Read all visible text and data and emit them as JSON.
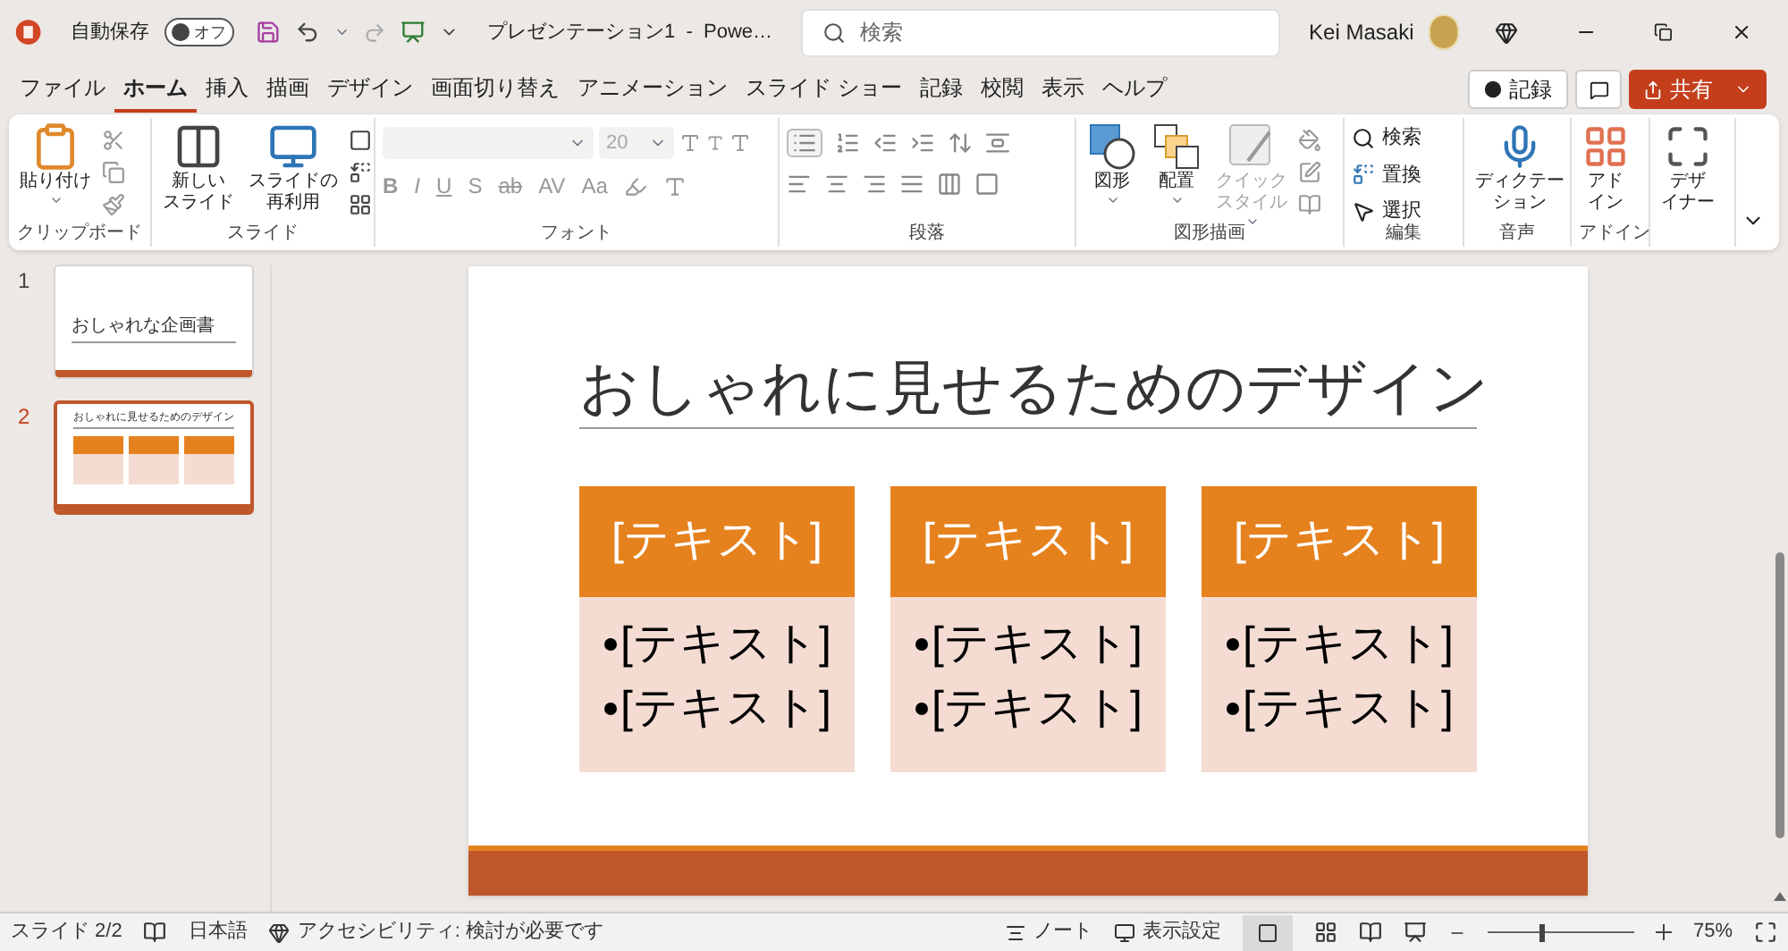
{
  "title_bar": {
    "autosave_label": "自動保存",
    "autosave": {
      "label": "オフ",
      "on": false
    },
    "document_title": "プレゼンテーション1  -  Powe…",
    "search": {
      "placeholder": "検索"
    },
    "user": "Kei Masaki"
  },
  "menu_tabs": [
    {
      "label": "ファイル",
      "selected": false
    },
    {
      "label": "ホーム",
      "selected": true
    },
    {
      "label": "挿入",
      "selected": false
    },
    {
      "label": "描画",
      "selected": false
    },
    {
      "label": "デザイン",
      "selected": false
    },
    {
      "label": "画面切り替え",
      "selected": false
    },
    {
      "label": "アニメーション",
      "selected": false
    },
    {
      "label": "スライド ショー",
      "selected": false
    },
    {
      "label": "記録",
      "selected": false
    },
    {
      "label": "校閲",
      "selected": false
    },
    {
      "label": "表示",
      "selected": false
    },
    {
      "label": "ヘルプ",
      "selected": false
    }
  ],
  "header_buttons": {
    "record": "記録",
    "share": "共有"
  },
  "ribbon": {
    "clipboard": {
      "paste": [
        "貼り付け"
      ],
      "label": "クリップボード"
    },
    "slides": {
      "new_slide": [
        "新しい",
        "スライド"
      ],
      "reuse": [
        "スライドの",
        "再利用"
      ],
      "label": "スライド"
    },
    "font": {
      "size": "20",
      "buttons": [
        "B",
        "I",
        "U",
        "S",
        "ab",
        "AV",
        "Aa"
      ],
      "label": "フォント"
    },
    "paragraph": {
      "label": "段落"
    },
    "drawing": {
      "items": [
        {
          "kind": "shapes",
          "label": [
            "図形"
          ],
          "disabled": false
        },
        {
          "kind": "arrange",
          "label": [
            "配置"
          ],
          "disabled": false
        },
        {
          "kind": "quick_style",
          "label": [
            "クイック",
            "スタイル"
          ],
          "disabled": true
        }
      ],
      "label": "図形描画"
    },
    "editing": {
      "items": [
        {
          "kind": "find",
          "label": "検索"
        },
        {
          "kind": "replace",
          "label": "置換"
        },
        {
          "kind": "select",
          "label": "選択"
        }
      ],
      "label": "編集"
    },
    "voice": {
      "dictate": [
        "ディクテー",
        "ション"
      ],
      "label": "音声"
    },
    "addins": {
      "button": [
        "アド",
        "イン"
      ],
      "label": "アドイン"
    },
    "designer": {
      "button": [
        "デザ",
        "イナー"
      ]
    }
  },
  "thumbnails": [
    {
      "number": "1",
      "kind": "title_slide",
      "title": "おしゃれな企画書",
      "selected": false
    },
    {
      "number": "2",
      "kind": "three_columns",
      "title": "おしゃれに見せるためのデザイン",
      "selected": true
    }
  ],
  "slide": {
    "title": "おしゃれに見せるためのデザイン",
    "cards": [
      {
        "header": "[テキスト]",
        "bullets": [
          "[テキスト]",
          "[テキスト]"
        ]
      },
      {
        "header": "[テキスト]",
        "bullets": [
          "[テキスト]",
          "[テキスト]"
        ]
      },
      {
        "header": "[テキスト]",
        "bullets": [
          "[テキスト]",
          "[テキスト]"
        ]
      }
    ]
  },
  "status_bar": {
    "slide": "スライド 2/2",
    "language": "日本語",
    "accessibility": "アクセシビリティ: 検討が必要です",
    "notes": "ノート",
    "display_settings": "表示設定",
    "zoom": {
      "level": 0.37
    },
    "zoom_reading": "75%"
  }
}
